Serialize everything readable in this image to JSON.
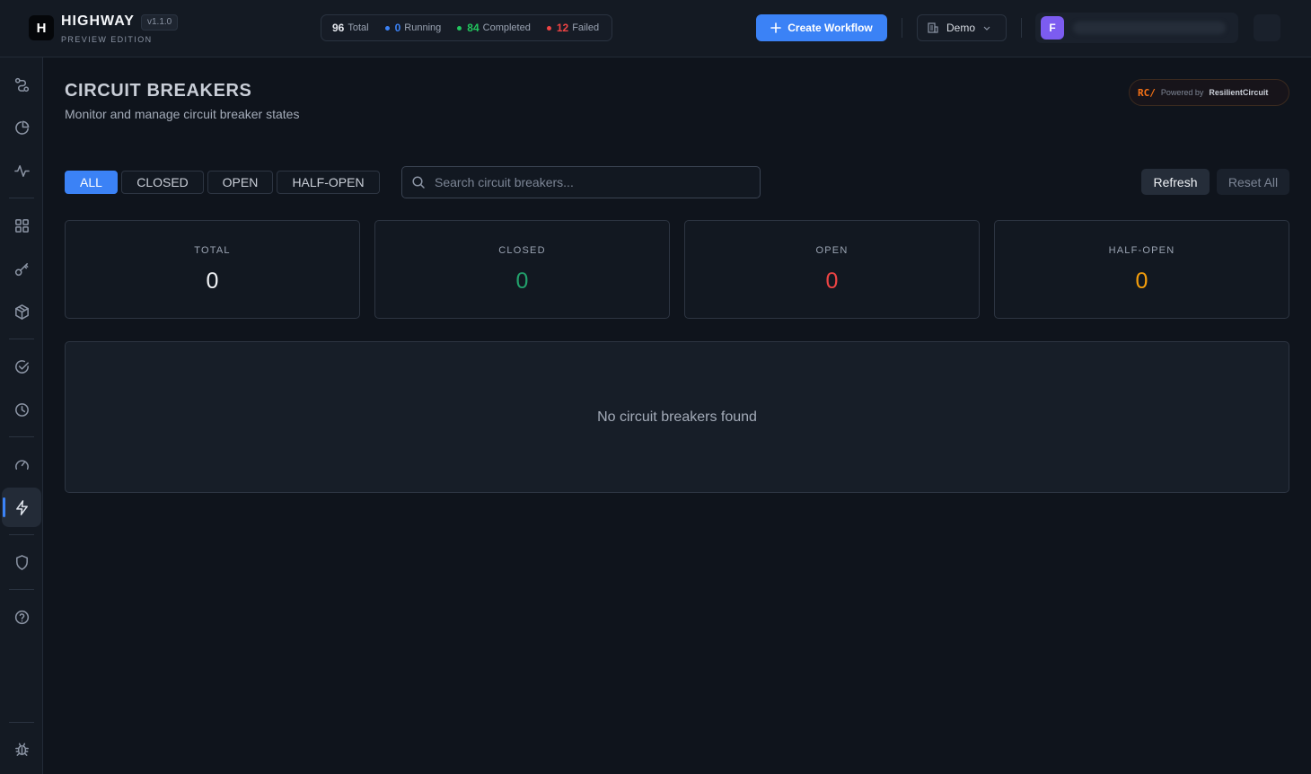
{
  "brand": {
    "logo_letter": "H",
    "name": "HIGHWAY",
    "version": "v1.1.0",
    "edition": "PREVIEW EDITION"
  },
  "stats": {
    "total_count": "96",
    "total_label": "Total",
    "running_count": "0",
    "running_label": "Running",
    "completed_count": "84",
    "completed_label": "Completed",
    "failed_count": "12",
    "failed_label": "Failed"
  },
  "header": {
    "create_label": "Create Workflow",
    "org_label": "Demo",
    "user_initial": "F"
  },
  "sidebar": {
    "items": [
      {
        "icon": "workflow-icon"
      },
      {
        "icon": "pie-chart-icon"
      },
      {
        "icon": "activity-icon"
      },
      {
        "icon": "grid-icon"
      },
      {
        "icon": "key-icon"
      },
      {
        "icon": "package-icon"
      },
      {
        "icon": "check-circle-icon"
      },
      {
        "icon": "clock-icon"
      },
      {
        "icon": "gauge-icon"
      },
      {
        "icon": "zap-icon",
        "active": true
      },
      {
        "icon": "shield-icon"
      },
      {
        "icon": "help-circle-icon"
      },
      {
        "icon": "bug-icon"
      }
    ]
  },
  "page": {
    "title": "CIRCUIT BREAKERS",
    "subtitle": "Monitor and manage circuit breaker states"
  },
  "powered": {
    "logo": "RC/",
    "label": "Powered by",
    "name": "ResilientCircuit"
  },
  "filters": {
    "all": "ALL",
    "closed": "CLOSED",
    "open": "OPEN",
    "half_open": "HALF-OPEN",
    "selected": "ALL"
  },
  "search": {
    "placeholder": "Search circuit breakers..."
  },
  "actions": {
    "refresh": "Refresh",
    "reset_all": "Reset All"
  },
  "cards": {
    "total": {
      "label": "TOTAL",
      "value": "0"
    },
    "closed": {
      "label": "CLOSED",
      "value": "0"
    },
    "open": {
      "label": "OPEN",
      "value": "0"
    },
    "half_open": {
      "label": "HALF-OPEN",
      "value": "0"
    }
  },
  "empty_state": {
    "message": "No circuit breakers found"
  },
  "colors": {
    "accent": "#3b82f6",
    "closed": "#22a06b",
    "open": "#ef4444",
    "half_open": "#f59e0b",
    "running": "#3b82f6",
    "completed": "#22c55e",
    "failed": "#ef4444"
  }
}
